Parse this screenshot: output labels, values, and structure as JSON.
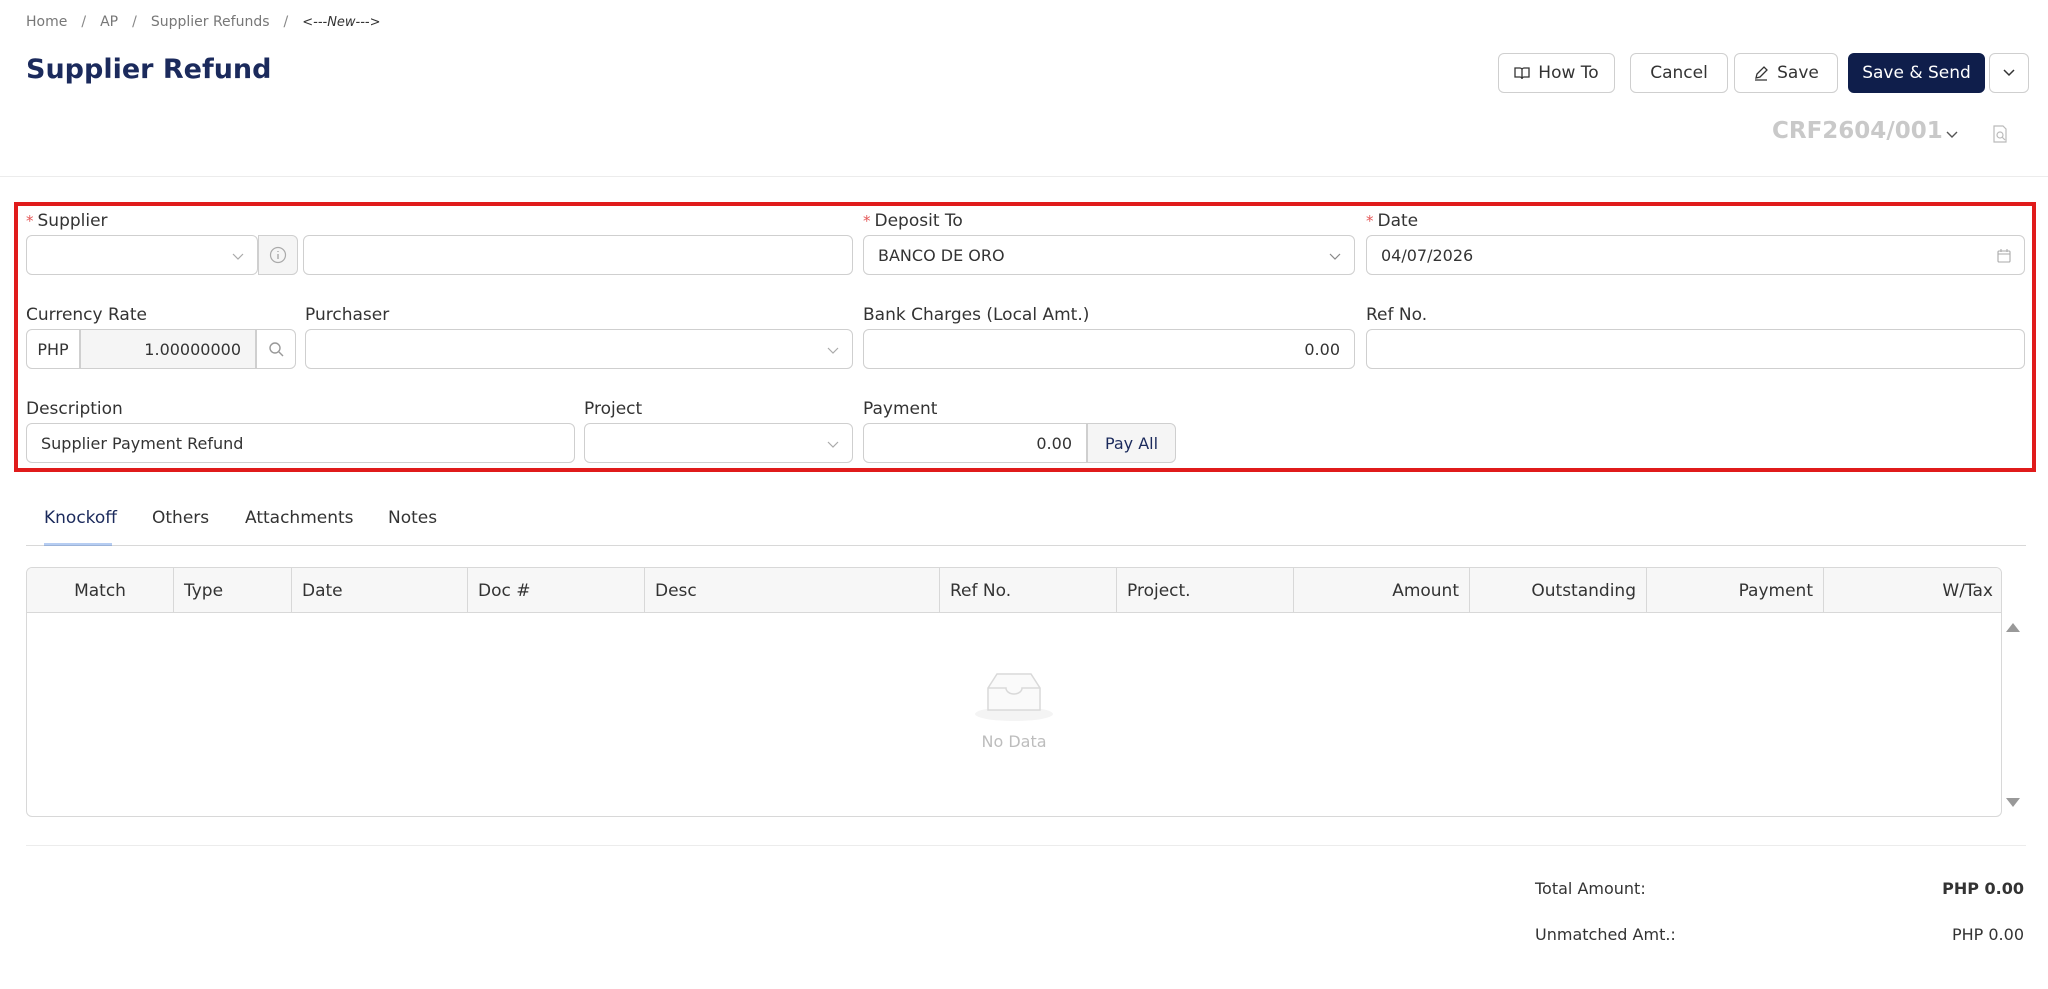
{
  "breadcrumb": {
    "home": "Home",
    "ap": "AP",
    "refunds": "Supplier Refunds",
    "current": "<---New--->",
    "sep": "/"
  },
  "page": {
    "title": "Supplier Refund",
    "doc_no": "CRF2604/001"
  },
  "actions": {
    "how_to": "How To",
    "cancel": "Cancel",
    "save": "Save",
    "save_send": "Save & Send"
  },
  "form": {
    "supplier": {
      "label": "Supplier",
      "code": "",
      "name": ""
    },
    "deposit_to": {
      "label": "Deposit To",
      "value": "BANCO DE ORO"
    },
    "date": {
      "label": "Date",
      "value": "04/07/2026"
    },
    "currency_rate": {
      "label": "Currency Rate",
      "currency": "PHP",
      "rate": "1.00000000"
    },
    "purchaser": {
      "label": "Purchaser",
      "value": ""
    },
    "bank_charges": {
      "label": "Bank Charges (Local Amt.)",
      "value": "0.00"
    },
    "ref_no": {
      "label": "Ref No.",
      "value": ""
    },
    "description": {
      "label": "Description",
      "value": "Supplier Payment Refund"
    },
    "project": {
      "label": "Project",
      "value": ""
    },
    "payment": {
      "label": "Payment",
      "value": "0.00",
      "pay_all": "Pay All"
    }
  },
  "tabs": [
    "Knockoff",
    "Others",
    "Attachments",
    "Notes"
  ],
  "table": {
    "columns": [
      "Match",
      "Type",
      "Date",
      "Doc #",
      "Desc",
      "Ref No.",
      "Project.",
      "Amount",
      "Outstanding",
      "Payment",
      "W/Tax"
    ],
    "empty_text": "No Data"
  },
  "summary": {
    "total_label": "Total Amount:",
    "total_value": "PHP 0.00",
    "unmatched_label": "Unmatched Amt.:",
    "unmatched_value": "PHP 0.00"
  },
  "colors": {
    "primary": "#0f1e4b",
    "highlight": "#e01b1b",
    "required": "#e45858"
  }
}
